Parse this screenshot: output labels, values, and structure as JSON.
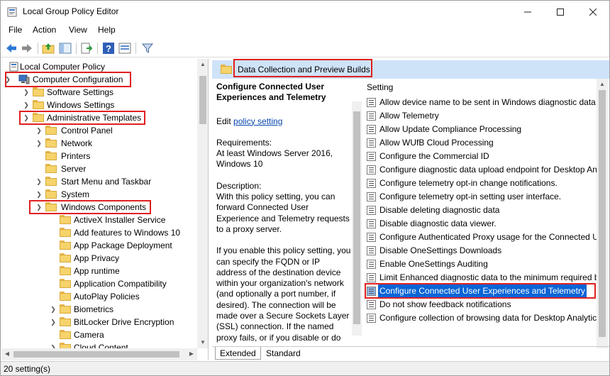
{
  "window": {
    "title": "Local Group Policy Editor"
  },
  "menu": [
    "File",
    "Action",
    "View",
    "Help"
  ],
  "tree": [
    {
      "label": "Local Computer Policy",
      "level": 0
    },
    {
      "label": "Computer Configuration",
      "level": 0,
      "expanded": true,
      "highlighted": true
    },
    {
      "label": "Software Settings",
      "level": 1
    },
    {
      "label": "Windows Settings",
      "level": 1
    },
    {
      "label": "Administrative Templates",
      "level": 1,
      "expanded": true,
      "highlighted": true
    },
    {
      "label": "Control Panel",
      "level": 2
    },
    {
      "label": "Network",
      "level": 2
    },
    {
      "label": "Printers",
      "level": 2
    },
    {
      "label": "Server",
      "level": 2
    },
    {
      "label": "Start Menu and Taskbar",
      "level": 2
    },
    {
      "label": "System",
      "level": 2
    },
    {
      "label": "Windows Components",
      "level": 2,
      "expanded": true,
      "highlighted": true
    },
    {
      "label": "ActiveX Installer Service",
      "level": 3
    },
    {
      "label": "Add features to Windows 10",
      "level": 3
    },
    {
      "label": "App Package Deployment",
      "level": 3
    },
    {
      "label": "App Privacy",
      "level": 3
    },
    {
      "label": "App runtime",
      "level": 3
    },
    {
      "label": "Application Compatibility",
      "level": 3
    },
    {
      "label": "AutoPlay Policies",
      "level": 3
    },
    {
      "label": "Biometrics",
      "level": 3
    },
    {
      "label": "BitLocker Drive Encryption",
      "level": 3
    },
    {
      "label": "Camera",
      "level": 3
    },
    {
      "label": "Cloud Content",
      "level": 3
    }
  ],
  "right": {
    "folder_title": "Data Collection and Preview Builds",
    "policy_title": "Configure Connected User Experiences and Telemetry",
    "edit_prefix": "Edit",
    "edit_link": "policy setting",
    "requirements_label": "Requirements:",
    "requirements_text": "At least Windows Server 2016, Windows 10",
    "description_label": "Description:",
    "description_p1": "With this policy setting, you can forward Connected User Experience and Telemetry requests to a proxy server.",
    "description_p2": "If you enable this policy setting, you can specify the FQDN or IP address of the destination device within your organization's network (and optionally a port number, if desired). The connection will be made over a Secure Sockets Layer (SSL) connection.  If the named proxy fails, or if you disable or do not",
    "setting_header": "Setting",
    "settings": [
      "Allow device name to be sent in Windows diagnostic data",
      "Allow Telemetry",
      "Allow Update Compliance Processing",
      "Allow WUfB Cloud Processing",
      "Configure the Commercial ID",
      "Configure diagnostic data upload endpoint for Desktop Analytics",
      "Configure telemetry opt-in change notifications.",
      "Configure telemetry opt-in setting user interface.",
      "Disable deleting diagnostic data",
      "Disable diagnostic data viewer.",
      "Configure Authenticated Proxy usage for the Connected User Experience",
      "Disable OneSettings Downloads",
      "Enable OneSettings Auditing",
      "Limit Enhanced diagnostic data to the minimum required by Windows Analytics",
      "Configure Connected User Experiences and Telemetry",
      "Do not show feedback notifications",
      "Configure collection of browsing data for Desktop Analytics"
    ],
    "selected_index": 14,
    "tabs": [
      "Extended",
      "Standard"
    ]
  },
  "status": "20 setting(s)"
}
